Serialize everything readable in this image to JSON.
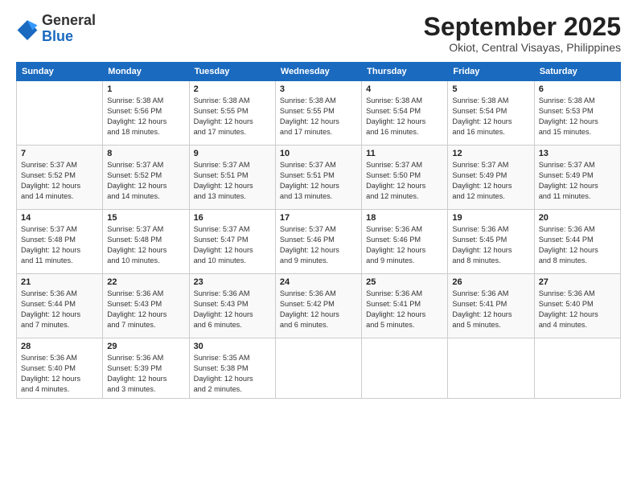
{
  "header": {
    "logo_general": "General",
    "logo_blue": "Blue",
    "month": "September 2025",
    "location": "Okiot, Central Visayas, Philippines"
  },
  "weekdays": [
    "Sunday",
    "Monday",
    "Tuesday",
    "Wednesday",
    "Thursday",
    "Friday",
    "Saturday"
  ],
  "weeks": [
    [
      {
        "day": "",
        "info": ""
      },
      {
        "day": "1",
        "info": "Sunrise: 5:38 AM\nSunset: 5:56 PM\nDaylight: 12 hours\nand 18 minutes."
      },
      {
        "day": "2",
        "info": "Sunrise: 5:38 AM\nSunset: 5:55 PM\nDaylight: 12 hours\nand 17 minutes."
      },
      {
        "day": "3",
        "info": "Sunrise: 5:38 AM\nSunset: 5:55 PM\nDaylight: 12 hours\nand 17 minutes."
      },
      {
        "day": "4",
        "info": "Sunrise: 5:38 AM\nSunset: 5:54 PM\nDaylight: 12 hours\nand 16 minutes."
      },
      {
        "day": "5",
        "info": "Sunrise: 5:38 AM\nSunset: 5:54 PM\nDaylight: 12 hours\nand 16 minutes."
      },
      {
        "day": "6",
        "info": "Sunrise: 5:38 AM\nSunset: 5:53 PM\nDaylight: 12 hours\nand 15 minutes."
      }
    ],
    [
      {
        "day": "7",
        "info": "Sunrise: 5:37 AM\nSunset: 5:52 PM\nDaylight: 12 hours\nand 14 minutes."
      },
      {
        "day": "8",
        "info": "Sunrise: 5:37 AM\nSunset: 5:52 PM\nDaylight: 12 hours\nand 14 minutes."
      },
      {
        "day": "9",
        "info": "Sunrise: 5:37 AM\nSunset: 5:51 PM\nDaylight: 12 hours\nand 13 minutes."
      },
      {
        "day": "10",
        "info": "Sunrise: 5:37 AM\nSunset: 5:51 PM\nDaylight: 12 hours\nand 13 minutes."
      },
      {
        "day": "11",
        "info": "Sunrise: 5:37 AM\nSunset: 5:50 PM\nDaylight: 12 hours\nand 12 minutes."
      },
      {
        "day": "12",
        "info": "Sunrise: 5:37 AM\nSunset: 5:49 PM\nDaylight: 12 hours\nand 12 minutes."
      },
      {
        "day": "13",
        "info": "Sunrise: 5:37 AM\nSunset: 5:49 PM\nDaylight: 12 hours\nand 11 minutes."
      }
    ],
    [
      {
        "day": "14",
        "info": "Sunrise: 5:37 AM\nSunset: 5:48 PM\nDaylight: 12 hours\nand 11 minutes."
      },
      {
        "day": "15",
        "info": "Sunrise: 5:37 AM\nSunset: 5:48 PM\nDaylight: 12 hours\nand 10 minutes."
      },
      {
        "day": "16",
        "info": "Sunrise: 5:37 AM\nSunset: 5:47 PM\nDaylight: 12 hours\nand 10 minutes."
      },
      {
        "day": "17",
        "info": "Sunrise: 5:37 AM\nSunset: 5:46 PM\nDaylight: 12 hours\nand 9 minutes."
      },
      {
        "day": "18",
        "info": "Sunrise: 5:36 AM\nSunset: 5:46 PM\nDaylight: 12 hours\nand 9 minutes."
      },
      {
        "day": "19",
        "info": "Sunrise: 5:36 AM\nSunset: 5:45 PM\nDaylight: 12 hours\nand 8 minutes."
      },
      {
        "day": "20",
        "info": "Sunrise: 5:36 AM\nSunset: 5:44 PM\nDaylight: 12 hours\nand 8 minutes."
      }
    ],
    [
      {
        "day": "21",
        "info": "Sunrise: 5:36 AM\nSunset: 5:44 PM\nDaylight: 12 hours\nand 7 minutes."
      },
      {
        "day": "22",
        "info": "Sunrise: 5:36 AM\nSunset: 5:43 PM\nDaylight: 12 hours\nand 7 minutes."
      },
      {
        "day": "23",
        "info": "Sunrise: 5:36 AM\nSunset: 5:43 PM\nDaylight: 12 hours\nand 6 minutes."
      },
      {
        "day": "24",
        "info": "Sunrise: 5:36 AM\nSunset: 5:42 PM\nDaylight: 12 hours\nand 6 minutes."
      },
      {
        "day": "25",
        "info": "Sunrise: 5:36 AM\nSunset: 5:41 PM\nDaylight: 12 hours\nand 5 minutes."
      },
      {
        "day": "26",
        "info": "Sunrise: 5:36 AM\nSunset: 5:41 PM\nDaylight: 12 hours\nand 5 minutes."
      },
      {
        "day": "27",
        "info": "Sunrise: 5:36 AM\nSunset: 5:40 PM\nDaylight: 12 hours\nand 4 minutes."
      }
    ],
    [
      {
        "day": "28",
        "info": "Sunrise: 5:36 AM\nSunset: 5:40 PM\nDaylight: 12 hours\nand 4 minutes."
      },
      {
        "day": "29",
        "info": "Sunrise: 5:36 AM\nSunset: 5:39 PM\nDaylight: 12 hours\nand 3 minutes."
      },
      {
        "day": "30",
        "info": "Sunrise: 5:35 AM\nSunset: 5:38 PM\nDaylight: 12 hours\nand 2 minutes."
      },
      {
        "day": "",
        "info": ""
      },
      {
        "day": "",
        "info": ""
      },
      {
        "day": "",
        "info": ""
      },
      {
        "day": "",
        "info": ""
      }
    ]
  ]
}
